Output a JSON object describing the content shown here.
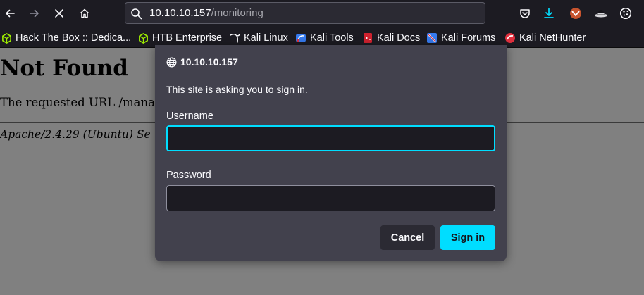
{
  "browser": {
    "url": {
      "host": "10.10.10.157",
      "path": "/monitoring"
    },
    "bookmarks": [
      {
        "label": "Hack The Box :: Dedica...",
        "icon": "htb-cube-icon"
      },
      {
        "label": "HTB Enterprise",
        "icon": "htb-cube-icon"
      },
      {
        "label": "Kali Linux",
        "icon": "kali-dragon-icon"
      },
      {
        "label": "Kali Tools",
        "icon": "kali-tools-icon"
      },
      {
        "label": "Kali Docs",
        "icon": "kali-docs-icon"
      },
      {
        "label": "Kali Forums",
        "icon": "kali-forums-icon"
      },
      {
        "label": "Kali NetHunter",
        "icon": "kali-nethunter-icon"
      }
    ]
  },
  "page": {
    "heading": "Not Found",
    "message": "The requested URL /manag",
    "address": "Apache/2.4.29 (Ubuntu) Se"
  },
  "dialog": {
    "host": "10.10.10.157",
    "prompt": "This site is asking you to sign in.",
    "username_label": "Username",
    "username_value": "",
    "password_label": "Password",
    "password_value": "",
    "cancel_label": "Cancel",
    "signin_label": "Sign in"
  },
  "colors": {
    "accent": "#00ddff",
    "chrome": "#1c1b22",
    "dialog": "#42414d"
  }
}
